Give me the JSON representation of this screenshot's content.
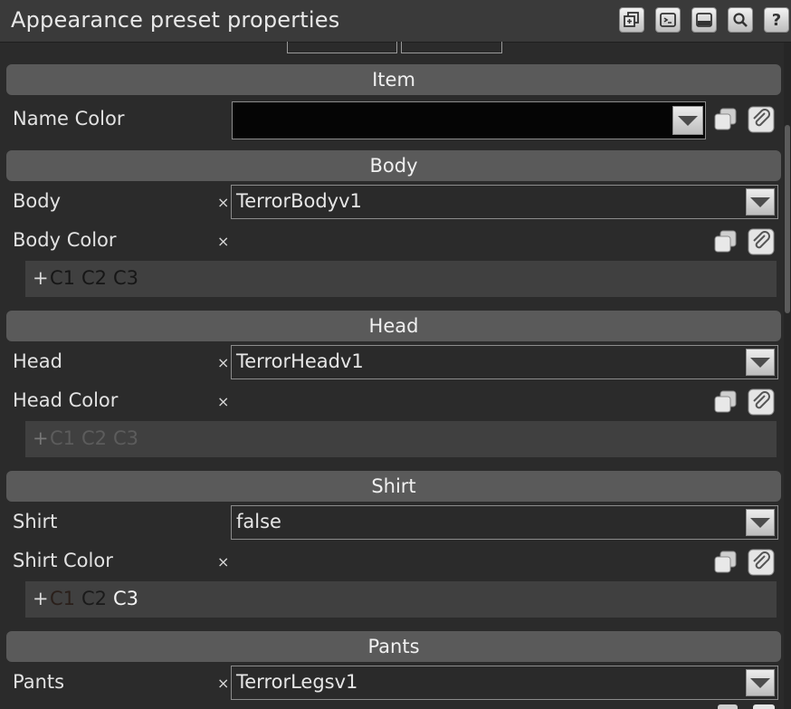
{
  "window": {
    "title": "Appearance preset properties",
    "buttons": [
      {
        "name": "new-window-icon",
        "glyph": "⧉"
      },
      {
        "name": "console-icon",
        "glyph": "▸"
      },
      {
        "name": "dock-icon",
        "glyph": "▬"
      },
      {
        "name": "search-icon",
        "glyph": "⌕"
      },
      {
        "name": "help-icon",
        "glyph": "?"
      }
    ]
  },
  "sections": {
    "item": {
      "title": "Item",
      "name_color_label": "Name Color",
      "name_color_value": "#050505"
    },
    "body": {
      "title": "Body",
      "body_label": "Body",
      "body_clear": "×",
      "body_value": "TerrorBodyv1",
      "color_label": "Body Color",
      "color_clear": "×",
      "color_add": "+",
      "color_tokens": [
        "C1",
        "C2",
        "C3"
      ],
      "token_colors": [
        "#161616",
        "#161616",
        "#161616"
      ]
    },
    "head": {
      "title": "Head",
      "head_label": "Head",
      "head_clear": "×",
      "head_value": "TerrorHeadv1",
      "color_label": "Head Color",
      "color_clear": "×",
      "color_add": "+",
      "color_tokens": [
        "C1",
        "C2",
        "C3"
      ],
      "token_colors": [
        "#5c5c5c",
        "#5c5c5c",
        "#5c5c5c"
      ]
    },
    "shirt": {
      "title": "Shirt",
      "shirt_label": "Shirt",
      "shirt_value": "false",
      "color_label": "Shirt Color",
      "color_clear": "×",
      "color_add": "+",
      "color_tokens": [
        "C1",
        "C2",
        "C3"
      ],
      "token_colors": [
        "#2a1f1a",
        "#1a1a1a",
        "#f2f2f2"
      ]
    },
    "pants": {
      "title": "Pants",
      "pants_label": "Pants",
      "pants_clear": "×",
      "pants_value": "TerrorLegsv1"
    }
  }
}
